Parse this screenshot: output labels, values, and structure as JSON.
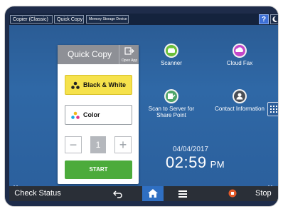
{
  "topbar": {
    "tabs": [
      "Copier (Classic)",
      "Quick Copy",
      "Memory Storage Device"
    ],
    "help_label": "?"
  },
  "quick_copy": {
    "title": "Quick Copy",
    "open_app_label": "Open App",
    "black_white_label": "Black & White",
    "color_label": "Color",
    "minus": "−",
    "quantity": "1",
    "plus": "+",
    "start_label": "START"
  },
  "apps": {
    "scanner": "Scanner",
    "cloud_fax": "Cloud Fax",
    "scan_to_server_line1": "Scan to Server for",
    "scan_to_server_line2": "Share Point",
    "contact_information": "Contact Information"
  },
  "clock": {
    "date": "04/04/2017",
    "time": "02:59",
    "ampm": "PM"
  },
  "bottombar": {
    "check_status": "Check Status",
    "stop": "Stop"
  },
  "colors": {
    "bw_selected": "#f6e24c",
    "start_green": "#4cab3b",
    "home_blue": "#2f6fc2"
  }
}
